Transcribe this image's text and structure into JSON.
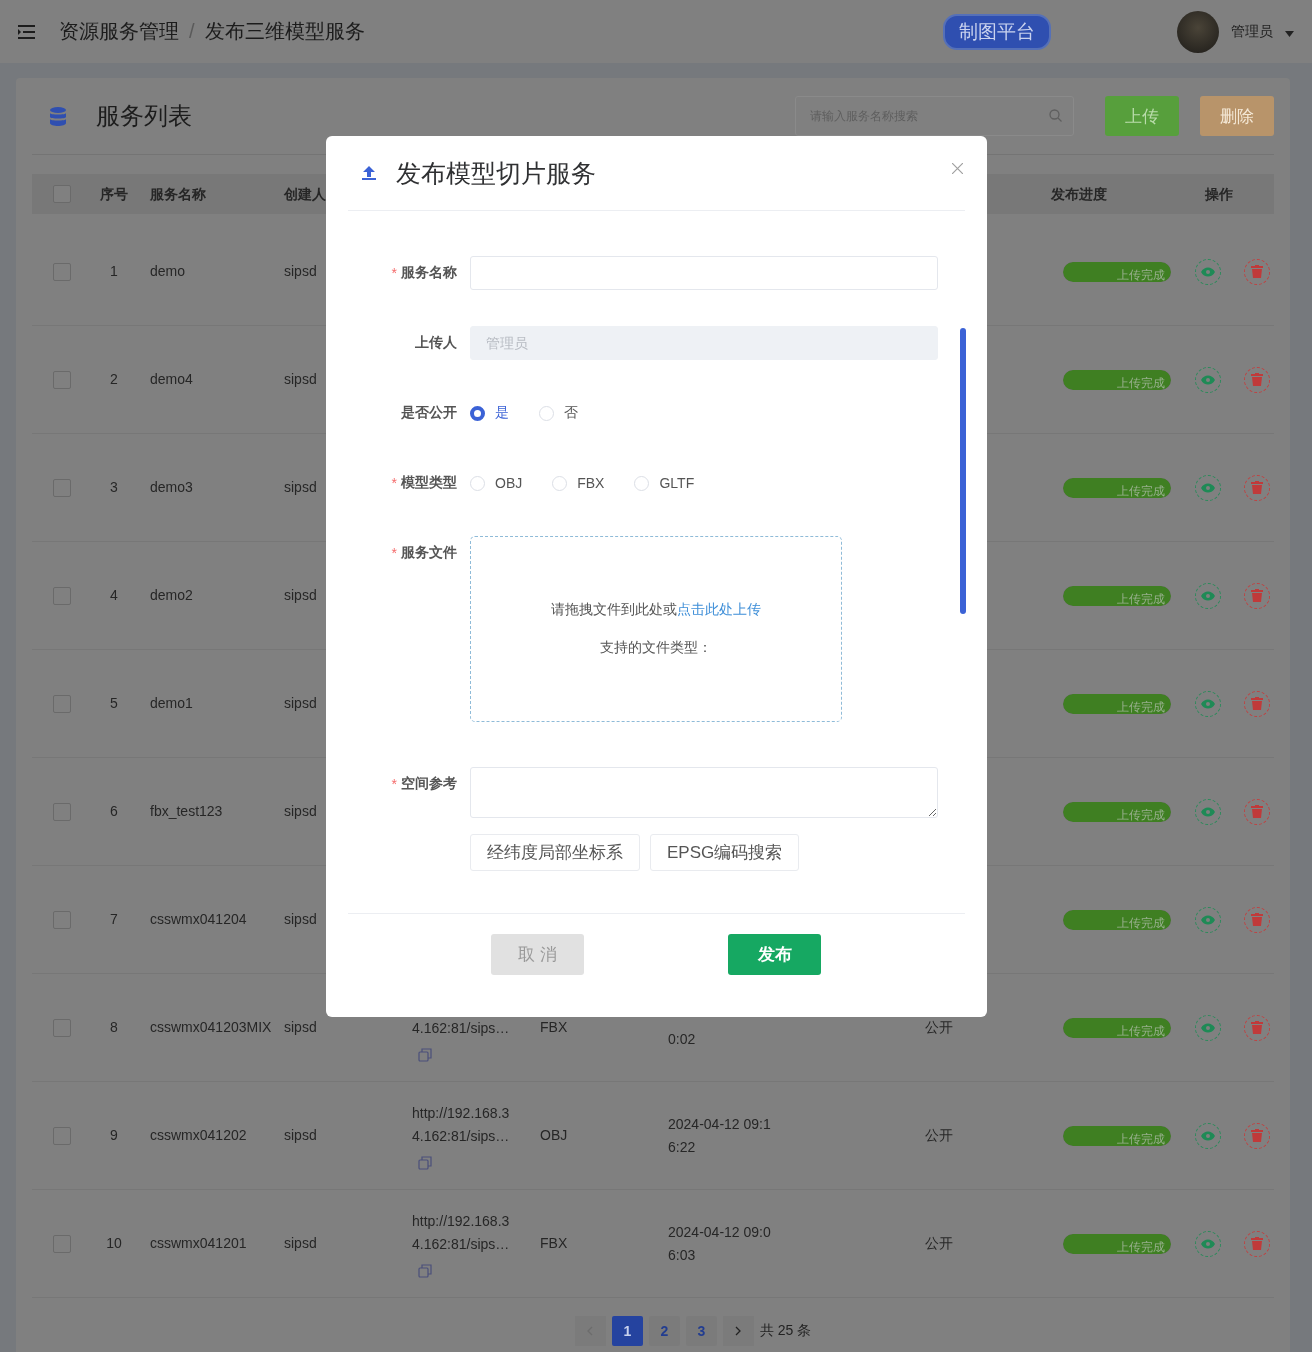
{
  "header": {
    "breadcrumb": [
      "资源服务管理",
      "发布三维模型服务"
    ],
    "separator": "/",
    "platform_button": "制图平台",
    "user": "管理员"
  },
  "card": {
    "title": "服务列表",
    "search": {
      "placeholder": "请输入服务名称搜索"
    },
    "buttons": [
      {
        "label": "上传",
        "kind": "primary",
        "disabled": false
      },
      {
        "label": "删除",
        "kind": "danger",
        "disabled": true
      }
    ]
  },
  "table": {
    "select_all_checked": false,
    "columns": {
      "index": "序号",
      "name": "服务名称",
      "creator": "创建人",
      "progress": "发布进度",
      "actions": "操作"
    },
    "rows": [
      {
        "checked": false,
        "index": "1",
        "name": "demo",
        "creator": "sipsd",
        "progress": {
          "label": "上传完成",
          "level": 1
        }
      },
      {
        "checked": false,
        "index": "2",
        "name": "demo4",
        "creator": "sipsd",
        "progress": {
          "label": "上传完成",
          "level": 1
        }
      },
      {
        "checked": false,
        "index": "3",
        "name": "demo3",
        "creator": "sipsd",
        "progress": {
          "label": "上传完成",
          "level": 1
        }
      },
      {
        "checked": false,
        "index": "4",
        "name": "demo2",
        "creator": "sipsd",
        "progress": {
          "label": "上传完成",
          "level": 1
        }
      },
      {
        "checked": false,
        "index": "5",
        "name": "demo1",
        "creator": "sipsd",
        "progress": {
          "label": "上传完成",
          "level": 1
        }
      },
      {
        "checked": false,
        "index": "6",
        "name": "fbx_test123",
        "creator": "sipsd",
        "progress": {
          "label": "上传完成",
          "level": 1
        }
      },
      {
        "checked": false,
        "index": "7",
        "name": "csswmx041204",
        "creator": "sipsd",
        "progress": {
          "label": "上传完成",
          "level": 1
        }
      },
      {
        "checked": false,
        "index": "8",
        "name": "csswmx041203MIX",
        "creator": "sipsd",
        "url": [
          "4.162:81/sips…"
        ],
        "type": "FBX",
        "time": [
          "0:02"
        ],
        "visibility": "公开",
        "progress": {
          "label": "上传完成",
          "level": 1
        }
      },
      {
        "checked": false,
        "index": "9",
        "name": "csswmx041202",
        "creator": "sipsd",
        "url": [
          "http://192.168.3",
          "4.162:81/sips…"
        ],
        "type": "OBJ",
        "time": [
          "2024-04-12 09:1",
          "6:22"
        ],
        "visibility": "公开",
        "progress": {
          "label": "上传完成",
          "level": 1
        }
      },
      {
        "checked": false,
        "index": "10",
        "name": "csswmx041201",
        "creator": "sipsd",
        "url": [
          "http://192.168.3",
          "4.162:81/sips…"
        ],
        "type": "FBX",
        "time": [
          "2024-04-12 09:0",
          "6:03"
        ],
        "visibility": "公开",
        "progress": {
          "label": "上传完成",
          "level": 1
        }
      }
    ]
  },
  "pagination": {
    "pages": [
      {
        "label": "1",
        "selected": true
      },
      {
        "label": "2",
        "selected": false
      },
      {
        "label": "3",
        "selected": false
      }
    ],
    "prev_disabled": true,
    "total": "共 25 条"
  },
  "dialog": {
    "title": "发布模型切片服务",
    "required_marker": "*",
    "fields": [
      {
        "kind": "input",
        "label": "服务名称",
        "required": true,
        "disabled": false
      },
      {
        "kind": "input",
        "label": "上传人",
        "required": false,
        "disabled": true,
        "placeholder": "管理员"
      },
      {
        "kind": "radio",
        "label": "是否公开",
        "required": false,
        "options": [
          {
            "label": "是",
            "selected": true
          },
          {
            "label": "否",
            "selected": false
          }
        ]
      },
      {
        "kind": "radio",
        "label": "模型类型",
        "required": true,
        "options": [
          {
            "label": "OBJ",
            "selected": false
          },
          {
            "label": "FBX",
            "selected": false
          },
          {
            "label": "GLTF",
            "selected": false
          }
        ]
      },
      {
        "kind": "upload",
        "label": "服务文件",
        "required": true,
        "prompt": "请拖拽文件到此处或",
        "link": "点击此处上传",
        "hint": "支持的文件类型："
      },
      {
        "kind": "textarea",
        "label": "空间参考",
        "required": true,
        "buttons": [
          "经纬度局部坐标系",
          "EPSG编码搜索"
        ]
      }
    ],
    "footer": [
      {
        "label": "取 消",
        "kind": "cancel"
      },
      {
        "label": "发布",
        "kind": "primary"
      }
    ]
  }
}
